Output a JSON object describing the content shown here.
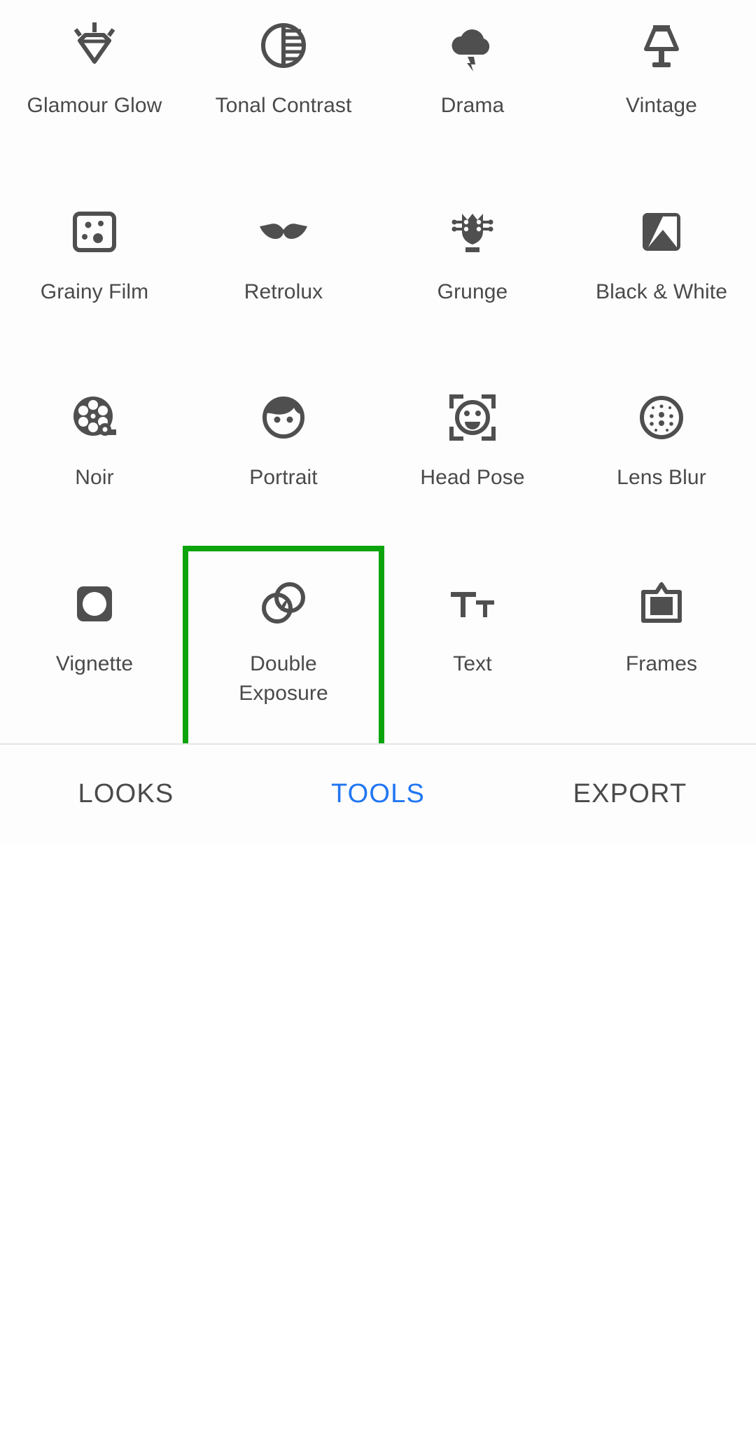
{
  "app": {
    "background": "#fdfdfd",
    "icon_color": "#4f4f4f",
    "label_color": "#4a4a4a",
    "highlight_color": "#0ca40c",
    "active_tab_color": "#2176f3"
  },
  "tools": {
    "items": [
      {
        "label": "Glamour Glow",
        "icon": "diamond-sparkle-icon",
        "selected": false
      },
      {
        "label": "Tonal Contrast",
        "icon": "half-circle-stripes-icon",
        "selected": false
      },
      {
        "label": "Drama",
        "icon": "cloud-lightning-icon",
        "selected": false
      },
      {
        "label": "Vintage",
        "icon": "table-lamp-icon",
        "selected": false
      },
      {
        "label": "Grainy Film",
        "icon": "grain-square-icon",
        "selected": false
      },
      {
        "label": "Retrolux",
        "icon": "mustache-icon",
        "selected": false
      },
      {
        "label": "Grunge",
        "icon": "guitar-headstock-icon",
        "selected": false
      },
      {
        "label": "Black & White",
        "icon": "split-square-icon",
        "selected": false
      },
      {
        "label": "Noir",
        "icon": "film-reel-icon",
        "selected": false
      },
      {
        "label": "Portrait",
        "icon": "face-portrait-icon",
        "selected": false
      },
      {
        "label": "Head Pose",
        "icon": "smiley-brackets-icon",
        "selected": false
      },
      {
        "label": "Lens Blur",
        "icon": "dotted-circle-icon",
        "selected": false
      },
      {
        "label": "Vignette",
        "icon": "vignette-square-icon",
        "selected": false
      },
      {
        "label": "Double Exposure",
        "icon": "overlapping-circles-icon",
        "selected": true
      },
      {
        "label": "Text",
        "icon": "text-tt-icon",
        "selected": false
      },
      {
        "label": "Frames",
        "icon": "picture-frame-icon",
        "selected": false
      }
    ]
  },
  "tabbar": {
    "tabs": [
      {
        "label": "LOOKS",
        "active": false
      },
      {
        "label": "TOOLS",
        "active": true
      },
      {
        "label": "EXPORT",
        "active": false
      }
    ]
  }
}
